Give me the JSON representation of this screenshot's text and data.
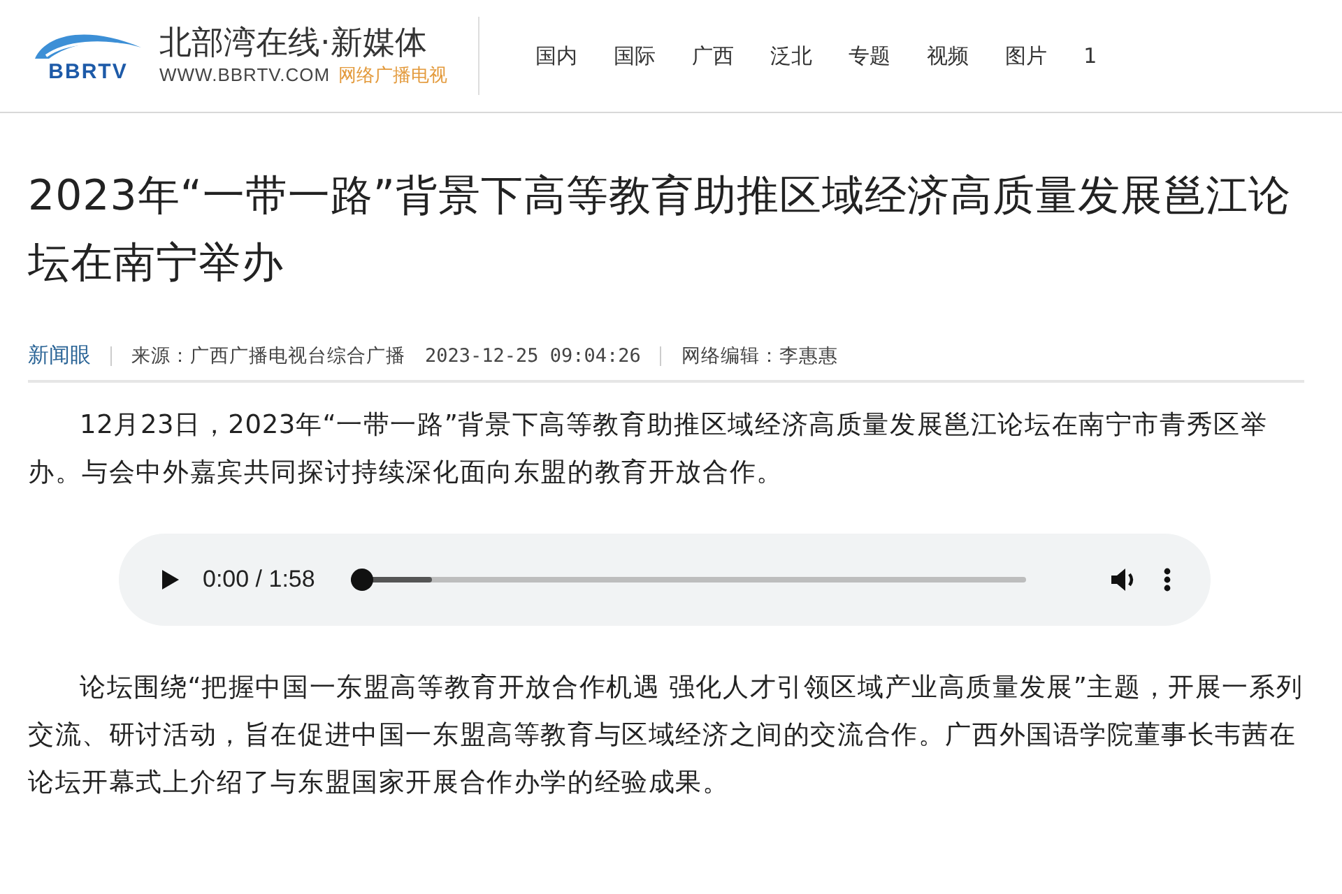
{
  "header": {
    "logo_mark": "BBRTV",
    "site_name": "北部湾在线·新媒体",
    "site_url": "WWW.BBRTV.COM",
    "site_tagline": "网络广播电视",
    "nav": [
      "国内",
      "国际",
      "广西",
      "泛北",
      "专题",
      "视频",
      "图片",
      "1"
    ]
  },
  "article": {
    "title": "2023年“一带一路”背景下高等教育助推区域经济高质量发展邕江论坛在南宁举办",
    "meta": {
      "channel": "新闻眼",
      "source": "来源：广西广播电视台综合广播",
      "time": "2023-12-25 09:04:26",
      "editor": "网络编辑：李惠惠"
    },
    "paragraphs_before": [
      "12月23日，2023年“一带一路”背景下高等教育助推区域经济高质量发展邕江论坛在南宁市青秀区举办。与会中外嘉宾共同探讨持续深化面向东盟的教育开放合作。"
    ],
    "audio": {
      "time": "0:00 / 1:58",
      "level": 0
    },
    "paragraphs_after": [
      "论坛围绕“把握中国一东盟高等教育开放合作机遇 强化人才引领区域产业高质量发展”主题，开展一系列交流、研讨活动，旨在促进中国一东盟高等教育与区域经济之间的交流合作。广西外国语学院董事长韦茜在论坛开幕式上介绍了与东盟国家开展合作办学的经验成果。"
    ]
  }
}
